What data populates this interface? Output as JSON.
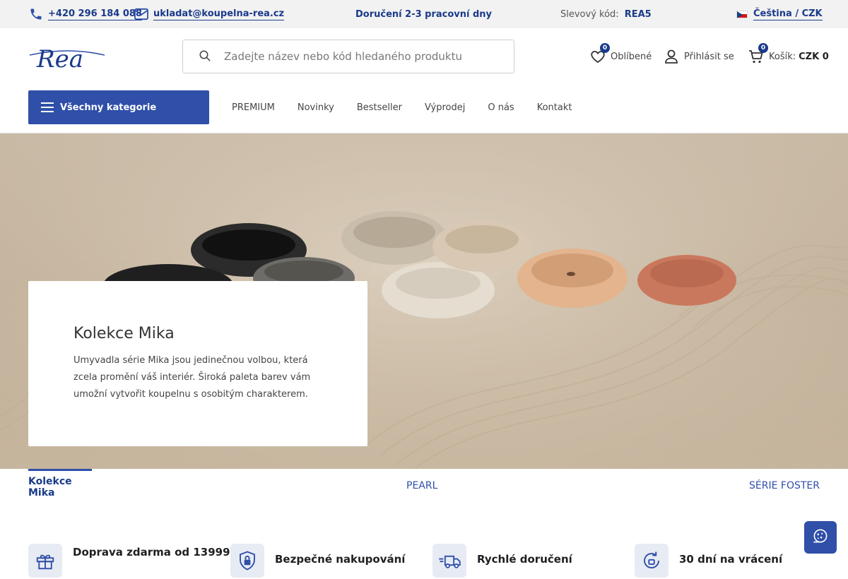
{
  "topbar": {
    "phone": "+420 296 184 088",
    "email": "ukladat@koupelna-rea.cz",
    "delivery": "Doručení 2-3 pracovní dny",
    "discount_label": "Slevový kód:",
    "discount_code": "REA5",
    "language": "Čeština / CZK"
  },
  "header": {
    "logo_text": "Rea",
    "search_placeholder": "Zadejte název nebo kód hledaného produktu",
    "favorites_label": "Oblíbené",
    "favorites_count": "0",
    "login_label": "Přihlásit se",
    "cart_label": "Košík:",
    "cart_total": "CZK 0",
    "cart_count": "0"
  },
  "nav": {
    "categories_label": "Všechny kategorie",
    "items": [
      "PREMIUM",
      "Novinky",
      "Bestseller",
      "Výprodej",
      "O nás",
      "Kontakt"
    ]
  },
  "hero": {
    "title": "Kolekce Mika",
    "text": "Umyvadla série Mika jsou jedinečnou volbou, která zcela promění váš interiér. Široká paleta barev vám umožní vytvořit koupelnu s osobitým charakterem."
  },
  "tabs": [
    "Kolekce Mika",
    "PEARL",
    "SÉRIE FOSTER"
  ],
  "benefits": [
    {
      "title": "Doprava zdarma od 13999",
      "icon": "gift-icon"
    },
    {
      "title": "Bezpečné nakupování",
      "icon": "lock-shield-icon"
    },
    {
      "title": "Rychlé doručení",
      "icon": "delivery-truck-icon"
    },
    {
      "title": "30 dní na vrácení",
      "icon": "return-icon"
    }
  ],
  "colors": {
    "brand": "#1a3a8a",
    "accent": "#2f4fa8"
  }
}
